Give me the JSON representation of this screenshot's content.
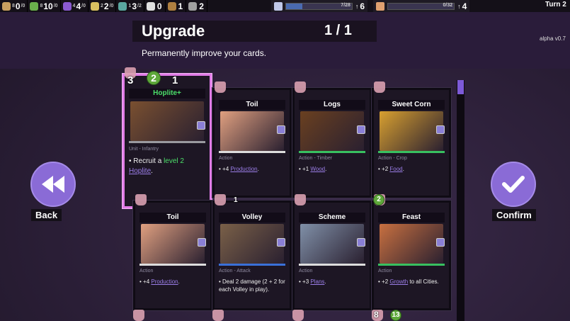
{
  "topbar": {
    "resources": [
      {
        "icon": "pop-icon",
        "color": "#c9a060",
        "a": "8",
        "big": "0",
        "b": "/0"
      },
      {
        "icon": "food-icon",
        "color": "#6ab04c",
        "a": "8",
        "big": "10",
        "b": "/0"
      },
      {
        "icon": "plans-icon",
        "color": "#8a5ad0",
        "a": "4",
        "big": "4",
        "b": "/0"
      },
      {
        "icon": "gold-icon",
        "color": "#d8c060",
        "a": "2",
        "big": "2",
        "b": "/0"
      },
      {
        "icon": "growth-icon",
        "color": "#5aa8a0",
        "a": "1",
        "big": "3",
        "b": "/2"
      },
      {
        "icon": "heart-icon",
        "color": "#e0e0e0",
        "a": "",
        "big": "0",
        "b": ""
      },
      {
        "icon": "wood-icon",
        "color": "#b08040",
        "a": "",
        "big": "1",
        "b": ""
      },
      {
        "icon": "production-icon",
        "color": "#a0a0a0",
        "a": "",
        "big": "2",
        "b": ""
      }
    ],
    "progress1": {
      "label": "7/28",
      "value": 0.25,
      "count": "6"
    },
    "progress2": {
      "label": "0/32",
      "value": 0.0,
      "count": "4"
    },
    "turn": "Turn 2"
  },
  "header": {
    "title": "Upgrade",
    "counter": "1 / 1",
    "subtitle": "Permanently improve your cards.",
    "version": "alpha v0.7"
  },
  "buttons": {
    "back": "Back",
    "confirm": "Confirm"
  },
  "cards": [
    {
      "name": "Hoplite+",
      "nameColor": "#4cdf6a",
      "type": "Unit - Infantry",
      "desc_pre": "• Recruit a ",
      "desc_hl": "level 2",
      "desc_link": "Hoplite",
      "desc_post": ".",
      "bar": "#9a9aa0",
      "art": "#7a5030",
      "cost_hand": "3",
      "cost_green": "2",
      "cost_flag": "1"
    },
    {
      "name": "Toil",
      "type": "Action",
      "desc_pre": "• +4 ",
      "desc_link": "Production",
      "desc_post": ".",
      "bar": "#dddddd",
      "art": "#e0a080"
    },
    {
      "name": "Logs",
      "type": "Action - Timber",
      "desc_pre": "• +1 ",
      "desc_link": "Wood",
      "desc_post": ".",
      "bar": "#38c060",
      "art": "#6a4020"
    },
    {
      "name": "Sweet Corn",
      "type": "Action - Crop",
      "desc_pre": "• +2 ",
      "desc_link": "Food",
      "desc_post": ".",
      "bar": "#38c060",
      "art": "#d8a030"
    },
    {
      "name": "Toil",
      "type": "Action",
      "desc_pre": "• +4 ",
      "desc_link": "Production",
      "desc_post": ".",
      "bar": "#dddddd",
      "art": "#e0a080"
    },
    {
      "name": "Volley",
      "type": "Action - Attack",
      "desc_pre": "• Deal 2 damage (2 + 2 for each Volley in play).",
      "desc_link": "",
      "desc_post": "",
      "bar": "#3a70d8",
      "art": "#7a6048",
      "cost_flag": "1"
    },
    {
      "name": "Scheme",
      "type": "Action",
      "desc_pre": "• +3 ",
      "desc_link": "Plans",
      "desc_post": ".",
      "bar": "#dddddd",
      "art": "#8090a8"
    },
    {
      "name": "Feast",
      "type": "Action",
      "desc_pre": "• +2 ",
      "desc_link": "Growth",
      "desc_post": " to all Cities.",
      "bar": "#38c060",
      "art": "#c87040",
      "cost_green": "2"
    }
  ],
  "bottom_row": {
    "hand": "8",
    "green": "13"
  }
}
